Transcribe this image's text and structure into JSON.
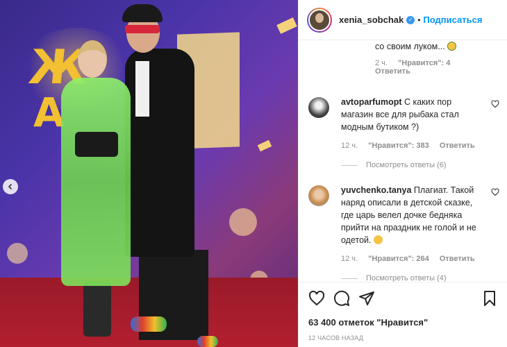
{
  "header": {
    "username": "xenia_sobchak",
    "separator": "•",
    "follow_label": "Подписаться",
    "verified_mark": "✓"
  },
  "comments": {
    "partial": {
      "text": "со своим луком...",
      "time": "2 ч.",
      "likes": "\"Нравится\": 4",
      "reply": "Ответить"
    },
    "items": [
      {
        "username": "avtoparfumopt",
        "text": "С каких пор магазин все для рыбака стал модным бутиком ?)",
        "time": "12 ч.",
        "likes": "\"Нравится\": 383",
        "reply": "Ответить",
        "view_replies": "Посмотреть ответы (6)"
      },
      {
        "username": "yuvchenko.tanya",
        "text": "Плагиат. Такой наряд описали в детской сказке, где царь велел дочке бедняка прийти на праздник не голой и не одетой.",
        "time": "12 ч.",
        "likes": "\"Нравится\": 264",
        "reply": "Ответить",
        "view_replies": "Посмотреть ответы (4)"
      }
    ]
  },
  "post": {
    "likes_text": "63 400 отметок \"Нравится\"",
    "time_text": "12 ЧАСОВ НАЗАД"
  },
  "colors": {
    "accent": "#0095f6",
    "verified": "#3897f0",
    "muted": "#8e8e8e",
    "text": "#262626"
  }
}
